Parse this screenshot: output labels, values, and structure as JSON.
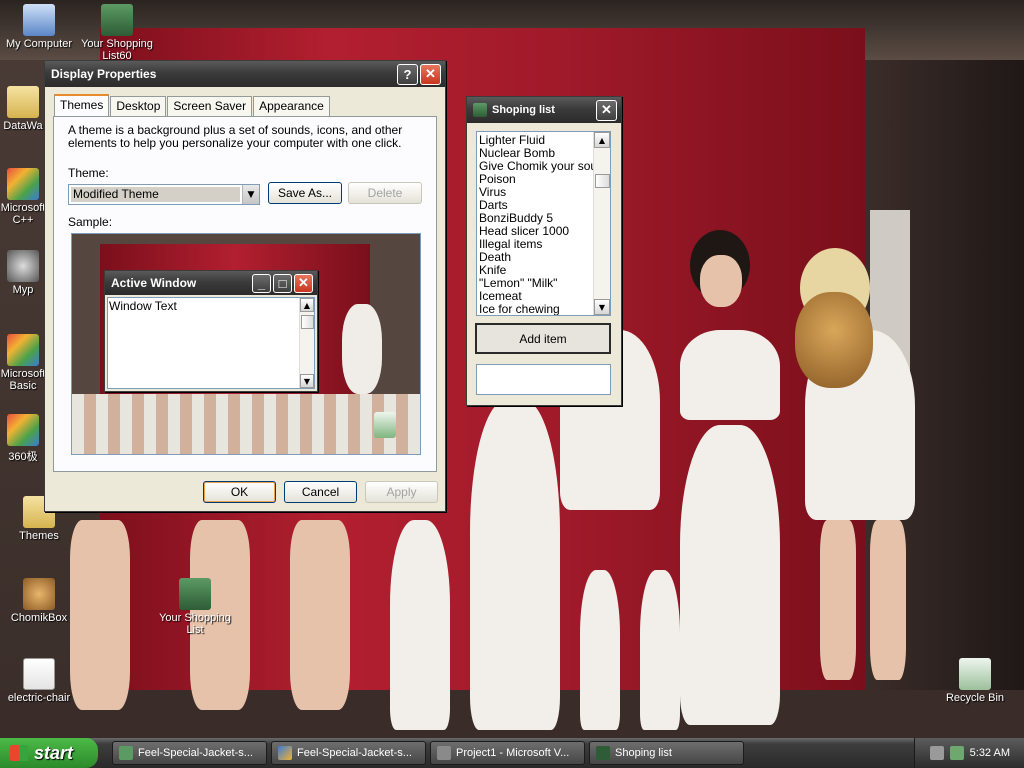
{
  "desktop": {
    "icons": [
      {
        "label": "My Computer",
        "icon": "computer-icon"
      },
      {
        "label": "Your Shopping List60",
        "icon": "house-icon"
      },
      {
        "label": "DataWa",
        "icon": "folder-icon"
      },
      {
        "label": "Microsoft C++",
        "icon": "app-icon"
      },
      {
        "label": "Myp",
        "icon": "raccoon-icon"
      },
      {
        "label": "Microsoft Basic",
        "icon": "app-icon"
      },
      {
        "label": "360极",
        "icon": "app-icon"
      },
      {
        "label": "Themes",
        "icon": "folder-icon"
      },
      {
        "label": "ChomikBox",
        "icon": "dog-icon"
      },
      {
        "label": "Your Shopping List",
        "icon": "house-icon"
      },
      {
        "label": "electric-chair",
        "icon": "document-icon"
      },
      {
        "label": "Recycle Bin",
        "icon": "recycle-bin-icon"
      }
    ]
  },
  "display_properties": {
    "title": "Display Properties",
    "help_glyph": "?",
    "close_glyph": "✕",
    "tabs": [
      "Themes",
      "Desktop",
      "Screen Saver",
      "Appearance"
    ],
    "active_tab": "Themes",
    "description": "A theme is a background plus a set of sounds, icons, and other elements to help you personalize your computer with one click.",
    "theme_label": "Theme:",
    "theme_value": "Modified Theme",
    "save_as_label": "Save As...",
    "delete_label": "Delete",
    "sample_label": "Sample:",
    "sample_window": {
      "title": "Active Window",
      "text": "Window Text"
    },
    "ok_label": "OK",
    "cancel_label": "Cancel",
    "apply_label": "Apply"
  },
  "shopping_list": {
    "title": "Shoping list",
    "close_glyph": "✕",
    "items": [
      "Lighter Fluid",
      "Nuclear Bomb",
      "Give Chomik your soul",
      "Poison",
      "Virus",
      "Darts",
      "BonziBuddy 5",
      "Head slicer 1000",
      "Illegal items",
      "Death",
      "Knife",
      "\"Lemon\" \"Milk\"",
      "Icemeat",
      "Ice for chewing"
    ],
    "add_item_label": "Add item",
    "input_value": ""
  },
  "taskbar": {
    "start_label": "start",
    "items": [
      {
        "label": "Feel-Special-Jacket-s...",
        "icon": "image-viewer-icon"
      },
      {
        "label": "Feel-Special-Jacket-s...",
        "icon": "paint-icon"
      },
      {
        "label": "Project1 - Microsoft V...",
        "icon": "visual-basic-icon"
      },
      {
        "label": "Shoping list",
        "icon": "house-icon"
      }
    ],
    "clock": "5:32 AM"
  },
  "colors": {
    "xp_close_red": "#c8361e",
    "start_green": "#2b8a2b",
    "tab_highlight": "#e68b2c"
  }
}
